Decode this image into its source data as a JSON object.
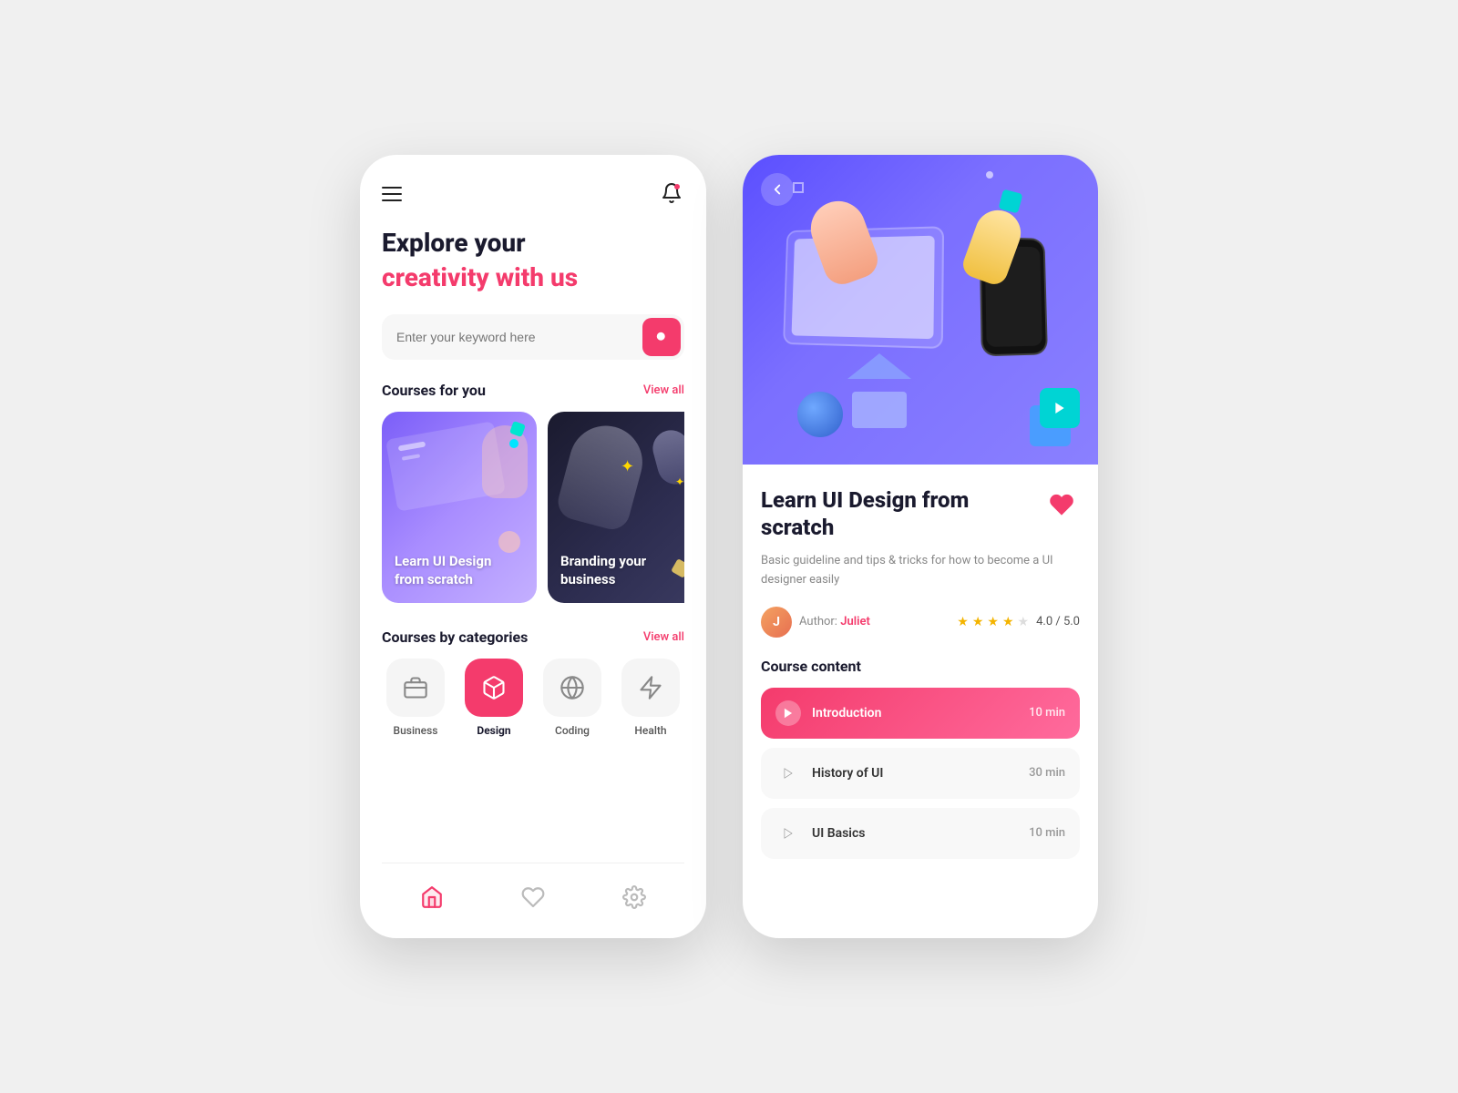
{
  "page": {
    "bg": "#f0f0f0"
  },
  "left_phone": {
    "hero_line1": "Explore your",
    "hero_line2": "creativity with us",
    "search_placeholder": "Enter your keyword here",
    "courses_section_label": "Courses for you",
    "view_all_1": "View all",
    "courses": [
      {
        "id": "card-learn-ui",
        "label_line1": "Learn UI Design",
        "label_line2": "from scratch",
        "gradient": "1"
      },
      {
        "id": "card-branding",
        "label_line1": "Branding your",
        "label_line2": "business",
        "gradient": "2"
      }
    ],
    "categories_section_label": "Courses by categories",
    "view_all_2": "View all",
    "categories": [
      {
        "id": "business",
        "label": "Business",
        "icon": "briefcase",
        "active": false
      },
      {
        "id": "design",
        "label": "Design",
        "icon": "box",
        "active": true
      },
      {
        "id": "coding",
        "label": "Coding",
        "icon": "globe",
        "active": false
      },
      {
        "id": "health",
        "label": "Health",
        "icon": "zap",
        "active": false
      }
    ],
    "nav": [
      {
        "id": "home",
        "icon": "home",
        "active": true
      },
      {
        "id": "wishlist",
        "icon": "heart",
        "active": false
      },
      {
        "id": "settings",
        "icon": "gear",
        "active": false
      }
    ]
  },
  "right_phone": {
    "course_title": "Learn UI Design from scratch",
    "course_desc": "Basic guideline and tips & tricks for how to become a UI designer easily",
    "author_label": "Author:",
    "author_name": "Juliet",
    "rating": "4.0 / 5.0",
    "stars_filled": 4,
    "stars_total": 5,
    "content_title": "Course content",
    "lessons": [
      {
        "id": "intro",
        "name": "Introduction",
        "duration": "10 min",
        "active": true
      },
      {
        "id": "history",
        "name": "History of UI",
        "duration": "30 min",
        "active": false
      },
      {
        "id": "basics",
        "name": "UI Basics",
        "duration": "10 min",
        "active": false
      }
    ]
  }
}
